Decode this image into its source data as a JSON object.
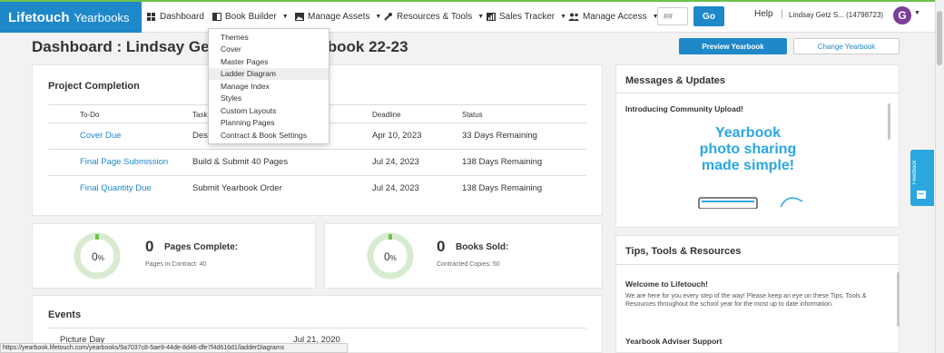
{
  "brand": {
    "name_bold": "Lifetouch",
    "name_rest": "Yearbooks"
  },
  "nav": {
    "dashboard": "Dashboard",
    "book_builder": "Book Builder",
    "manage_assets": "Manage Assets",
    "resources_tools": "Resources & Tools",
    "sales_tracker": "Sales Tracker",
    "manage_access": "Manage Access",
    "search_placeholder": "##",
    "go": "Go",
    "help": "Help",
    "separator": "|",
    "user": "Lindsay Getz S... (14798723)",
    "avatar_initial": "G"
  },
  "book_builder_menu": {
    "items": [
      "Themes",
      "Cover",
      "Master Pages",
      "Ladder Diagram",
      "Manage Index",
      "Styles",
      "Custom Layouts",
      "Planning Pages",
      "Contract & Book Settings"
    ],
    "highlighted": "Ladder Diagram"
  },
  "header": {
    "title_left": "Dashboard : Lindsay Getz",
    "title_right": "arbook 22-23",
    "preview_button": "Preview Yearbook",
    "change_button": "Change Yearbook"
  },
  "project_completion": {
    "title": "Project Completion",
    "columns": [
      "To-Do",
      "Task",
      "Deadline",
      "Status"
    ],
    "rows": [
      {
        "todo": "Cover Due",
        "task": "Des",
        "deadline": "Apr 10, 2023",
        "status": "33 Days Remaining"
      },
      {
        "todo": "Final Page Submission",
        "task": "Build & Submit 40 Pages",
        "deadline": "Jul 24, 2023",
        "status": "138 Days Remaining"
      },
      {
        "todo": "Final Quantity Due",
        "task": "Submit Yearbook Order",
        "deadline": "Jul 24, 2023",
        "status": "138 Days Remaining"
      }
    ]
  },
  "pages_stat": {
    "percent": "0",
    "percent_unit": "%",
    "value": "0",
    "label": "Pages Complete:",
    "sub": "Pages in Contract: 40",
    "progress": 0
  },
  "books_stat": {
    "percent": "0",
    "percent_unit": "%",
    "value": "0",
    "label": "Books Sold:",
    "sub": "Contracted Copies: 50",
    "progress": 0
  },
  "events": {
    "title": "Events",
    "rows": [
      {
        "name": "Picture Day",
        "date": "Jul 21, 2020"
      }
    ]
  },
  "messages": {
    "title": "Messages & Updates",
    "headline": "Introducing Community Upload!",
    "promo_line1": "Yearbook",
    "promo_line2": "photo sharing",
    "promo_line3": "made simple!"
  },
  "tips": {
    "title": "Tips, Tools & Resources",
    "welcome_title": "Welcome to Lifetouch!",
    "welcome_body": "We are here for you every step of the way! Please keep an eye on these Tips, Tools & Resources throughout the school year for the most up to date information.",
    "adviser_title": "Yearbook Adviser Support"
  },
  "feedback": {
    "label": "Feedback"
  },
  "status_url": "https://yearbook.lifetouch.com/yearbooks/9a7037c8-5ae9-44de-8d46-dfe7f4d616d1/ladderDiagrams",
  "colors": {
    "brand_blue": "#1e88c8",
    "accent_green": "#6bc24a",
    "promo_blue": "#2aa7df",
    "avatar_purple": "#7b3f98"
  }
}
